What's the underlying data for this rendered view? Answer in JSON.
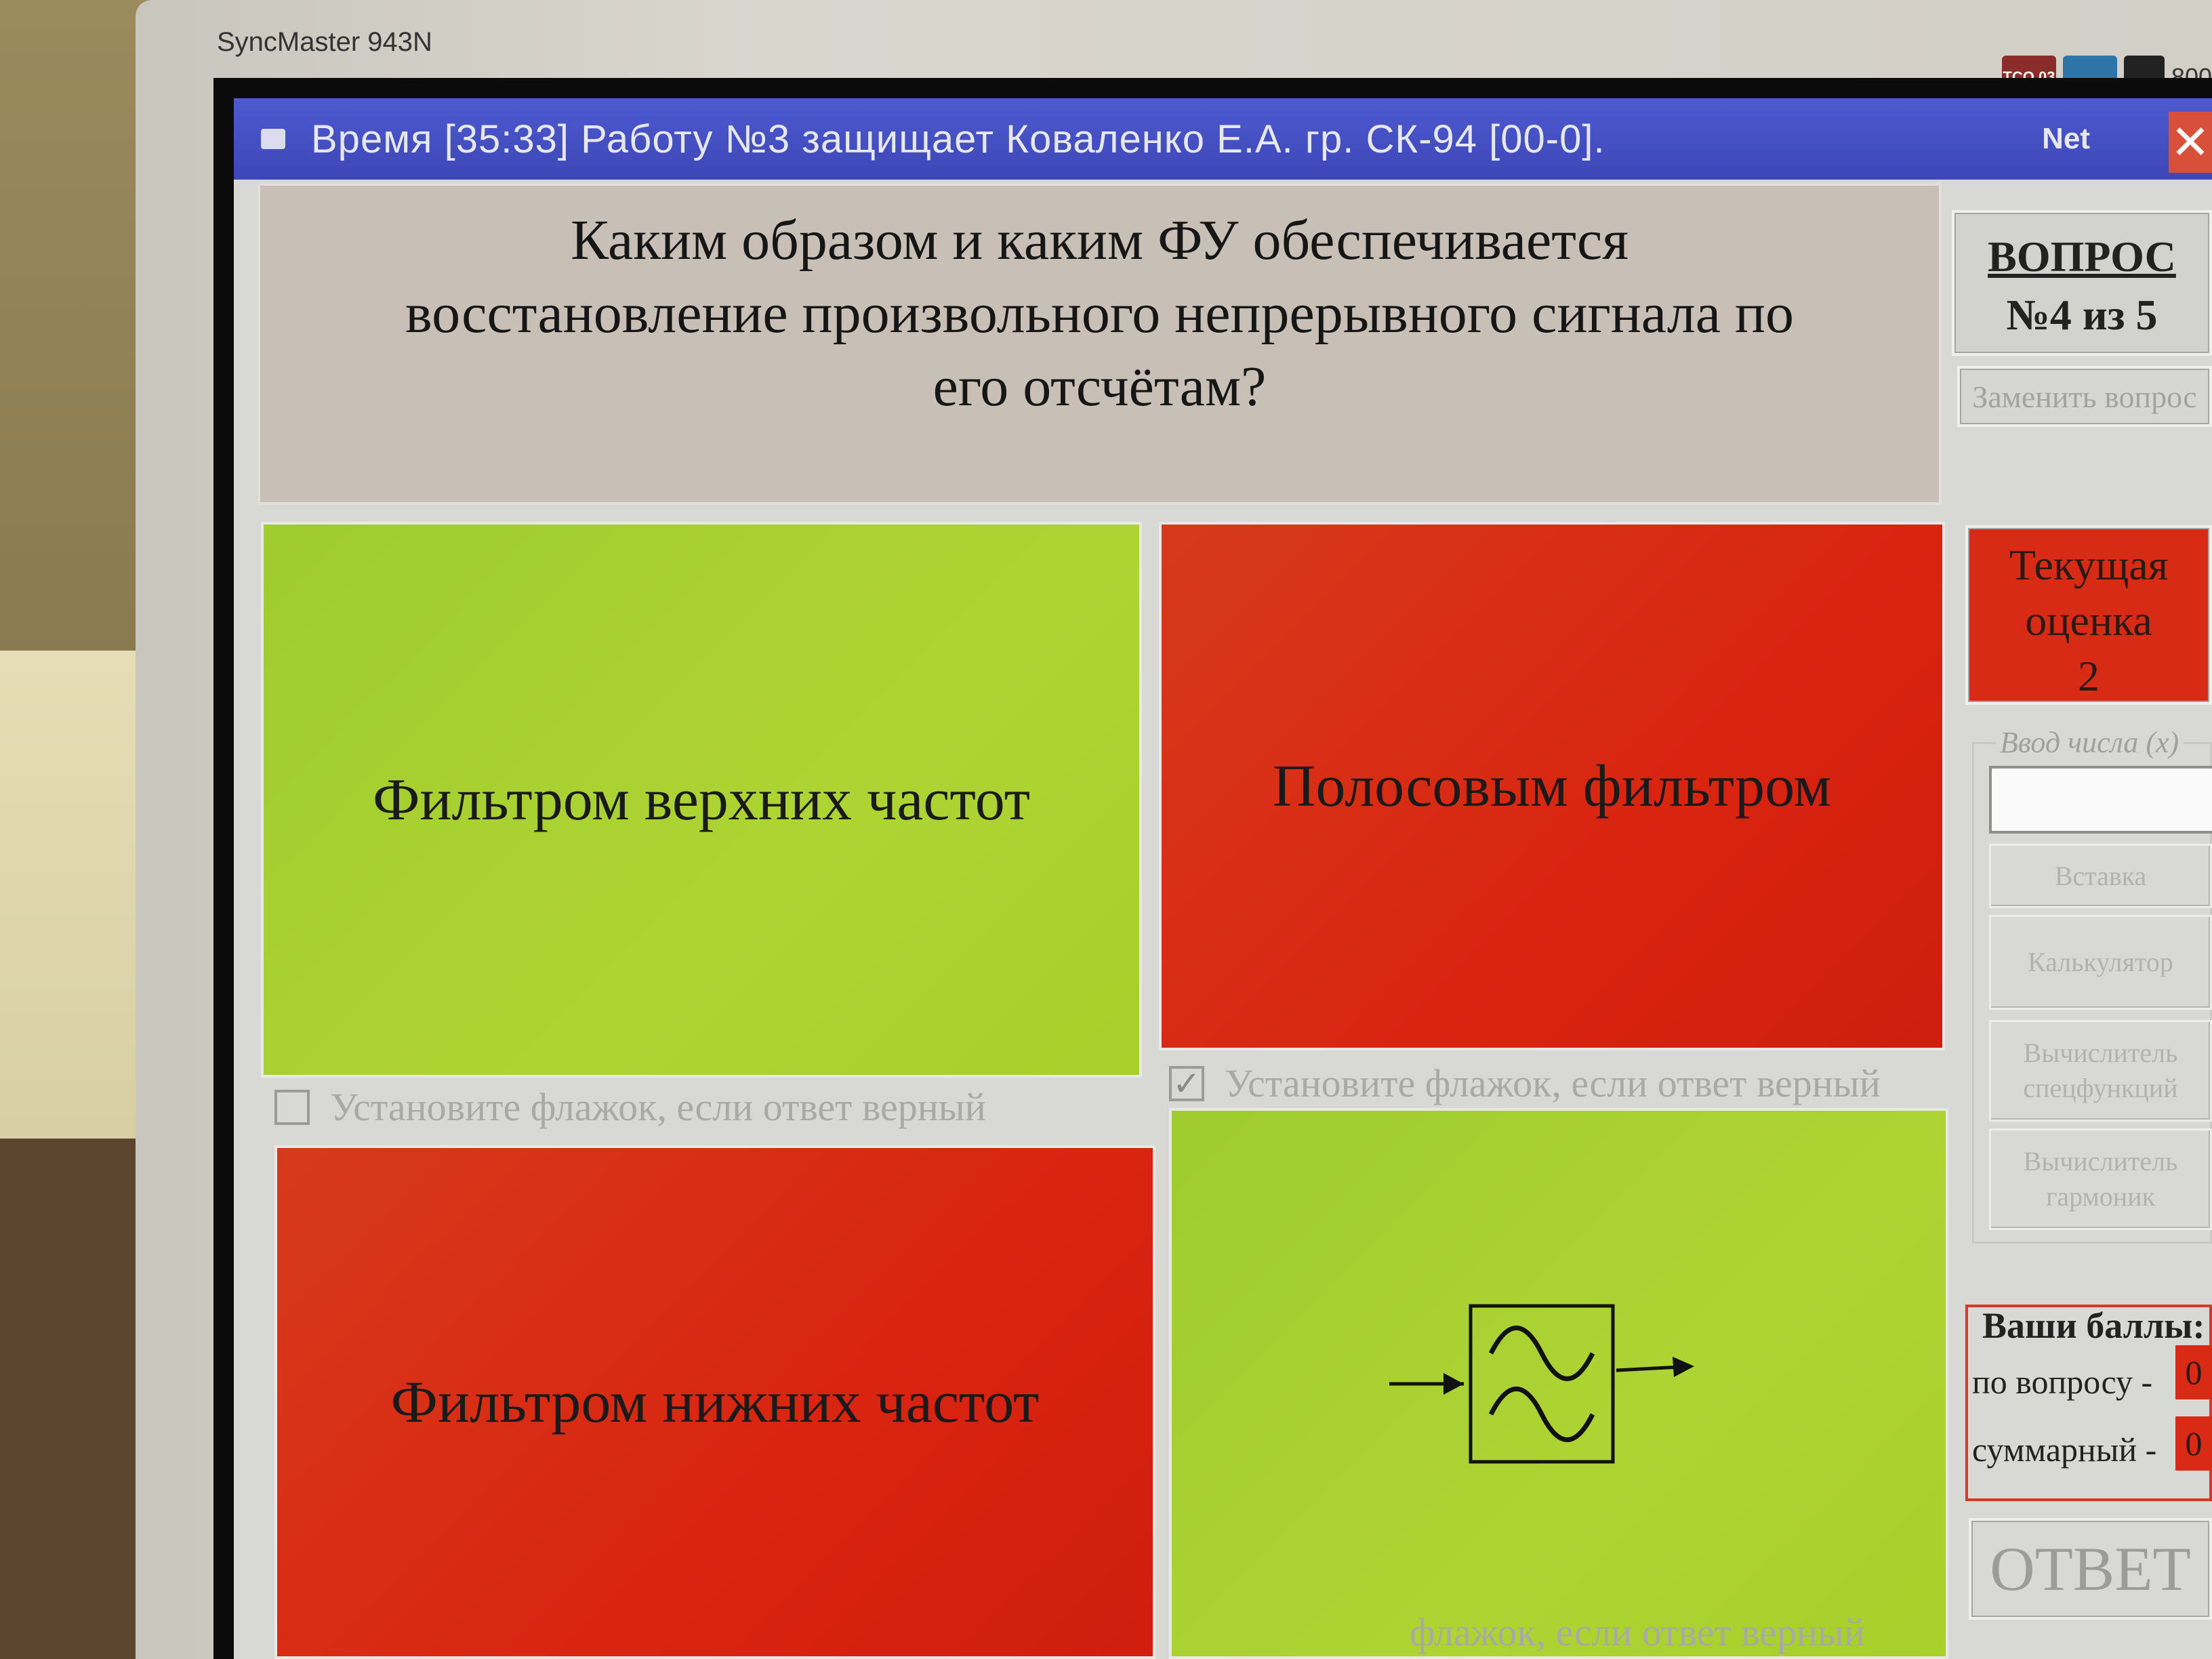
{
  "monitor": {
    "brand": "SyncMaster 943N",
    "badge_tco": "TCO 03",
    "badge_text": "800"
  },
  "window": {
    "title": "Время [35:33] Работу №3 защищает Коваленко Е.А.  гр. СК-94 [00-0].",
    "net_label": "Net",
    "close_glyph": "✕"
  },
  "question": {
    "text": "Каким образом и каким ФУ обеспечивается восстановление произвольного непрерывного сигнала по его отсчётам?"
  },
  "answers": [
    {
      "label": "Фильтром верхних частот",
      "color": "green",
      "checkbox_label": "Установите флажок, если ответ верный",
      "checked": false
    },
    {
      "label": "Полосовым фильтром",
      "color": "red",
      "checkbox_label": "Установите флажок, если ответ верный",
      "checked": true
    },
    {
      "label": "Фильтром нижних частот",
      "color": "red"
    },
    {
      "label": "",
      "color": "green",
      "icon": "filter-block-icon",
      "checkbox_label": "флажок, если ответ верный"
    }
  ],
  "sidebar": {
    "question_title": "ВОПРОС",
    "question_counter": "№4 из 5",
    "replace_button": "Заменить вопрос",
    "grade_title_1": "Текущая",
    "grade_title_2": "оценка",
    "grade_value": "2",
    "input_caption": "Ввод числа (x)",
    "input_value": "",
    "insert_button": "Вставка",
    "calc_button": "Калькулятор",
    "func_button": "Вычислитель спецфункций",
    "harm_button": "Вычислитель гармоник",
    "score_title": "Ваши баллы:",
    "score_question_label": "по вопросу -",
    "score_question_value": "0",
    "score_total_label": "суммарный -",
    "score_total_value": "0",
    "answer_button": "ОТВЕТ"
  },
  "colors": {
    "green": "#a7d02b",
    "red": "#d92410",
    "titlebar": "#4450c4"
  }
}
